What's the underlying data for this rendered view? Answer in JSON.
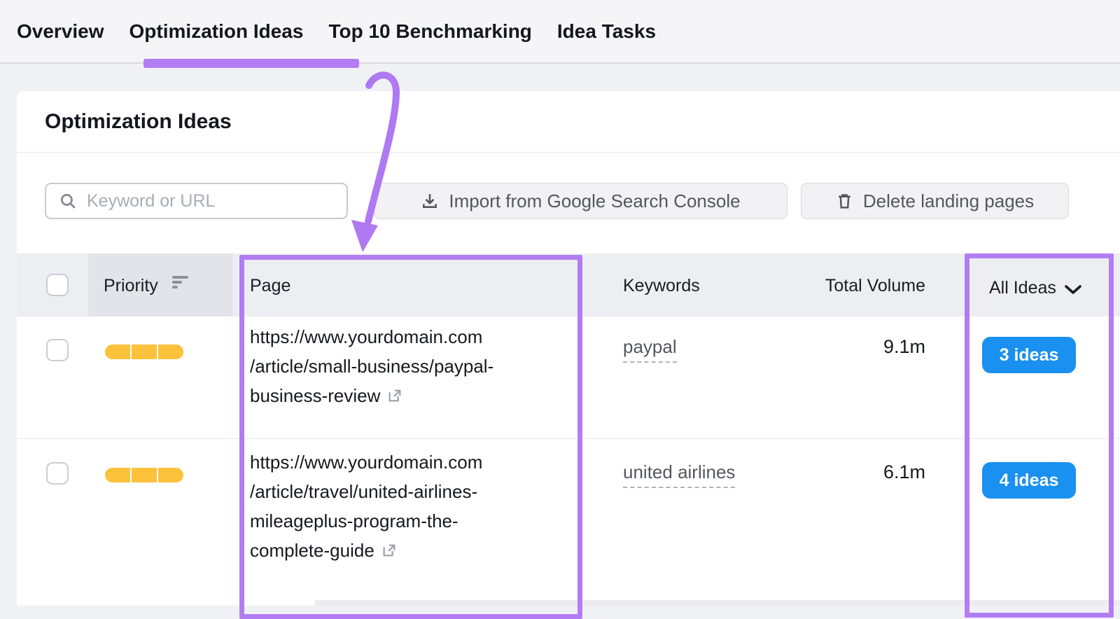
{
  "tabs": [
    {
      "label": "Overview",
      "active": false
    },
    {
      "label": "Optimization Ideas",
      "active": true
    },
    {
      "label": "Top 10 Benchmarking",
      "active": false
    },
    {
      "label": "Idea Tasks",
      "active": false
    }
  ],
  "panel": {
    "title": "Optimization Ideas"
  },
  "toolbar": {
    "search_placeholder": "Keyword or URL",
    "import_button": "Import from Google Search Console",
    "delete_button": "Delete landing pages"
  },
  "table": {
    "headers": {
      "priority": "Priority",
      "page": "Page",
      "keywords": "Keywords",
      "total_volume": "Total Volume",
      "ideas_filter": "All Ideas"
    },
    "rows": [
      {
        "priority_level": "3-of-3",
        "page_lines": [
          "https://www.yourdomain.com",
          "/article/small-business/paypal-",
          "business-review"
        ],
        "keyword": "paypal",
        "total_volume": "9.1m",
        "ideas": "3 ideas"
      },
      {
        "priority_level": "3-of-3",
        "page_lines": [
          "https://www.yourdomain.com",
          "/article/travel/united-airlines-",
          "mileageplus-program-the-",
          "complete-guide"
        ],
        "keyword": "united airlines",
        "total_volume": "6.1m",
        "ideas": "4 ideas"
      }
    ]
  },
  "colors": {
    "annotation_purple": "#b27df2",
    "ideas_button_blue": "#1a90f0",
    "priority_yellow": "#fcc23c",
    "header_row_gray": "#edeef2"
  }
}
